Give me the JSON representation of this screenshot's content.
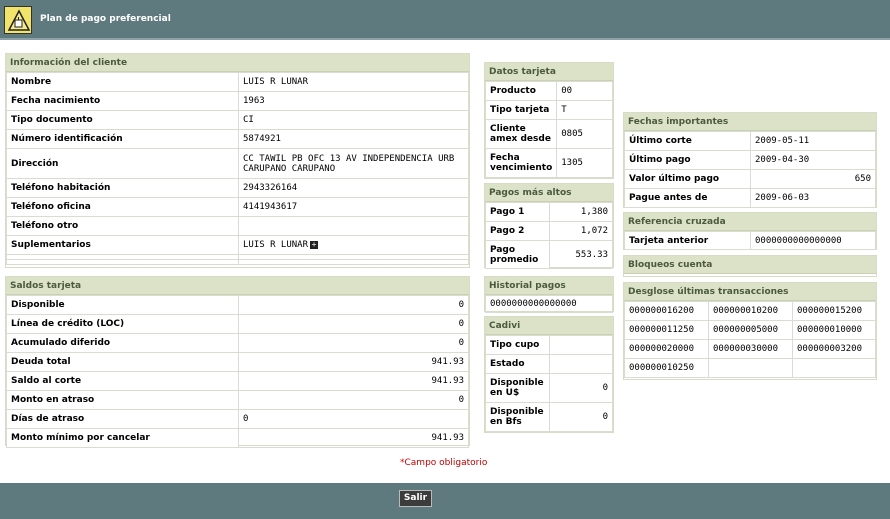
{
  "header": {
    "title": "Plan de pago preferencial"
  },
  "cliente": {
    "title": "Información del cliente",
    "rows": [
      {
        "label": "Nombre",
        "value": "LUIS R LUNAR"
      },
      {
        "label": "Fecha nacimiento",
        "value": "1963"
      },
      {
        "label": "Tipo documento",
        "value": "CI"
      },
      {
        "label": "Número identificación",
        "value": "5874921"
      },
      {
        "label": "Dirección",
        "value": "CC TAWIL PB OFC 13 AV INDEPENDENCIA URB CARUPANO CARUPANO"
      },
      {
        "label": "Teléfono habitación",
        "value": "2943326164"
      },
      {
        "label": "Teléfono oficina",
        "value": "4141943617"
      },
      {
        "label": "Teléfono otro",
        "value": ""
      },
      {
        "label": "Suplementarios",
        "value": "LUIS R LUNAR"
      }
    ]
  },
  "saldos": {
    "title": "Saldos tarjeta",
    "rows": [
      {
        "label": "Disponible",
        "value": "0"
      },
      {
        "label": "Línea de crédito (LOC)",
        "value": "0"
      },
      {
        "label": "Acumulado diferido",
        "value": "0"
      },
      {
        "label": "Deuda total",
        "value": "941.93"
      },
      {
        "label": "Saldo al corte",
        "value": "941.93"
      },
      {
        "label": "Monto en atraso",
        "value": "0"
      },
      {
        "label": "Días de atraso",
        "value": "0"
      },
      {
        "label": "Monto mínimo por cancelar",
        "value": "941.93"
      }
    ]
  },
  "datos_tarjeta": {
    "title": "Datos tarjeta",
    "rows": [
      {
        "label": "Producto",
        "value": "00"
      },
      {
        "label": "Tipo tarjeta",
        "value": "T"
      },
      {
        "label": "Cliente amex desde",
        "value": "0805"
      },
      {
        "label": "Fecha vencimiento",
        "value": "1305"
      }
    ]
  },
  "pagos": {
    "title": "Pagos más altos",
    "rows": [
      {
        "label": "Pago 1",
        "value": "1,380"
      },
      {
        "label": "Pago 2",
        "value": "1,072"
      },
      {
        "label": "Pago promedio",
        "value": "553.33"
      }
    ]
  },
  "historial": {
    "title": "Historial pagos",
    "value": "0000000000000000"
  },
  "cadivi": {
    "title": "Cadivi",
    "rows": [
      {
        "label": "Tipo cupo",
        "value": ""
      },
      {
        "label": "Estado",
        "value": ""
      },
      {
        "label": "Disponible en U$",
        "value": "0"
      },
      {
        "label": "Disponible en Bfs",
        "value": "0"
      }
    ]
  },
  "fechas": {
    "title": "Fechas importantes",
    "rows": [
      {
        "label": "Último corte",
        "value": "2009-05-11"
      },
      {
        "label": "Último pago",
        "value": "2009-04-30"
      },
      {
        "label": "Valor último pago",
        "value": "650"
      },
      {
        "label": "Pague antes de",
        "value": "2009-06-03"
      }
    ]
  },
  "referencia": {
    "title": "Referencia cruzada",
    "label": "Tarjeta anterior",
    "value": "0000000000000000"
  },
  "bloqueos": {
    "title": "Bloqueos cuenta"
  },
  "desglose": {
    "title": "Desglose últimas transacciones",
    "rows": [
      [
        "000000016200",
        "000000010200",
        "000000015200"
      ],
      [
        "000000011250",
        "000000005000",
        "000000010000"
      ],
      [
        "000000020000",
        "000000030000",
        "000000003200"
      ],
      [
        "000000010250",
        "",
        ""
      ]
    ]
  },
  "required_note": {
    "asterisk": "*",
    "text": "Campo obligatorio"
  },
  "footer": {
    "exit_label": "Salir"
  }
}
